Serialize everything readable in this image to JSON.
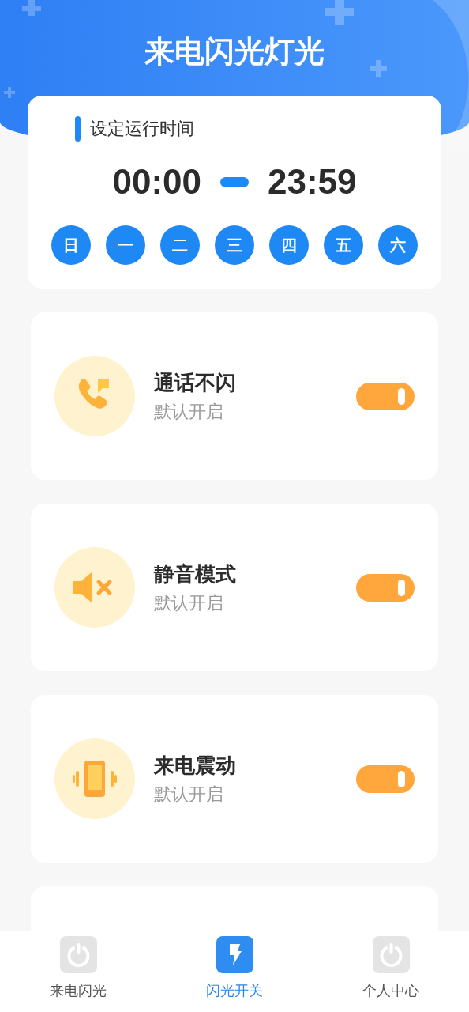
{
  "header": {
    "title": "来电闪光灯光"
  },
  "schedule": {
    "label": "设定运行时间",
    "start": "00:00",
    "end": "23:59",
    "days": [
      {
        "label": "日",
        "selected": true
      },
      {
        "label": "一",
        "selected": true
      },
      {
        "label": "二",
        "selected": true
      },
      {
        "label": "三",
        "selected": true
      },
      {
        "label": "四",
        "selected": true
      },
      {
        "label": "五",
        "selected": true
      },
      {
        "label": "六",
        "selected": true
      }
    ]
  },
  "settings": [
    {
      "kind": "phone",
      "title": "通话不闪",
      "subtitle": "默认开启",
      "on": true
    },
    {
      "kind": "mute",
      "title": "静音模式",
      "subtitle": "默认开启",
      "on": true
    },
    {
      "kind": "vibrate",
      "title": "来电震动",
      "subtitle": "默认开启",
      "on": true
    }
  ],
  "nav": [
    {
      "kind": "power",
      "label": "来电闪光",
      "selected": false
    },
    {
      "kind": "flash",
      "label": "闪光开关",
      "selected": true
    },
    {
      "kind": "power",
      "label": "个人中心",
      "selected": false
    }
  ]
}
